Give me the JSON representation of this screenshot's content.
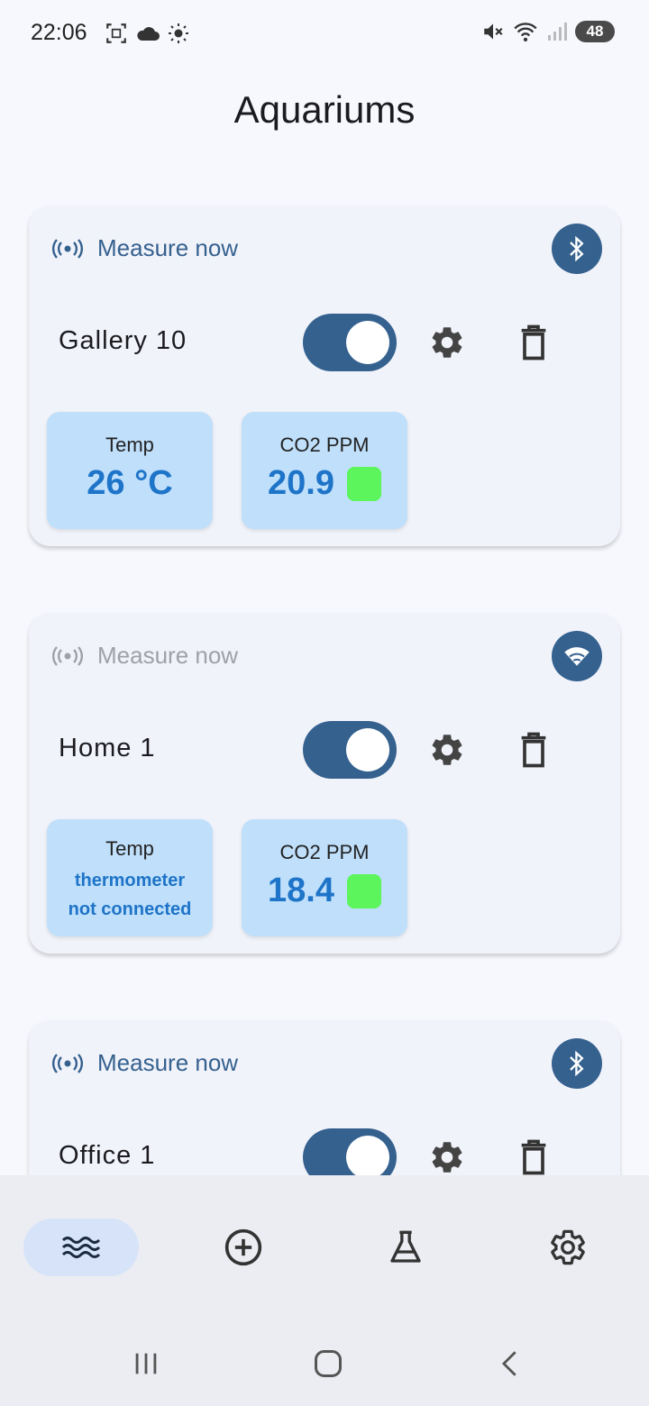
{
  "status_bar": {
    "time": "22:06",
    "battery": "48"
  },
  "title": "Aquariums",
  "aquariums": [
    {
      "measure_label": "Measure now",
      "measure_enabled": true,
      "connection": "bluetooth-icon",
      "name": "Gallery 10",
      "enabled": true,
      "temp": {
        "label": "Temp",
        "value": "26 °C",
        "note_line1": "",
        "note_line2": ""
      },
      "co2": {
        "label": "CO2 PPM",
        "value": "20.9",
        "status_color": "#5cf55c"
      }
    },
    {
      "measure_label": "Measure now",
      "measure_enabled": false,
      "connection": "wifi-icon",
      "name": "Home 1",
      "enabled": true,
      "temp": {
        "label": "Temp",
        "value": "",
        "note_line1": "thermometer",
        "note_line2": "not connected"
      },
      "co2": {
        "label": "CO2 PPM",
        "value": "18.4",
        "status_color": "#5cf55c"
      }
    },
    {
      "measure_label": "Measure now",
      "measure_enabled": true,
      "connection": "bluetooth-icon",
      "name": "Office 1",
      "enabled": true
    }
  ],
  "bottom_nav": [
    {
      "icon": "waves-icon",
      "active": true
    },
    {
      "icon": "add-circle-icon",
      "active": false
    },
    {
      "icon": "flask-icon",
      "active": false
    },
    {
      "icon": "settings-icon",
      "active": false
    }
  ],
  "colors": {
    "accent": "#35618f",
    "tile_bg": "#bfdffa",
    "value_text": "#1e74c8",
    "co2_ok": "#5cf55c"
  }
}
